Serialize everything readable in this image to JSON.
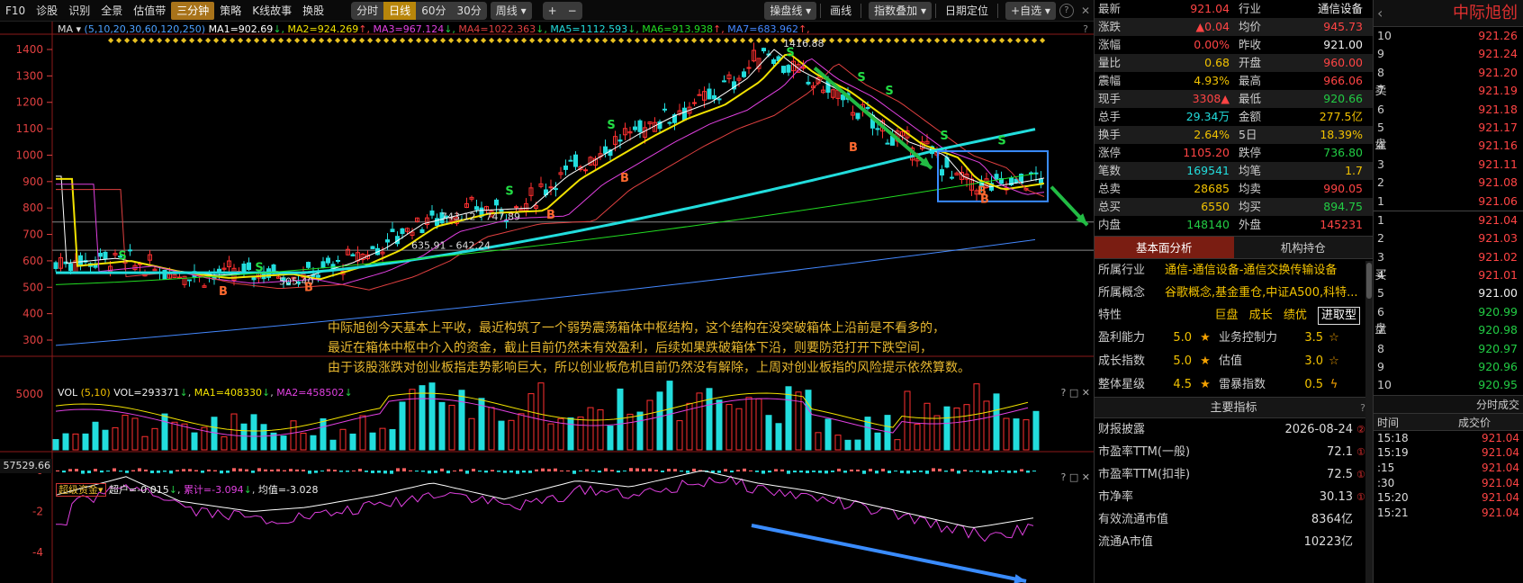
{
  "toolbar": {
    "left_items": [
      "F10",
      "诊股",
      "识别",
      "全景",
      "估值带",
      "三分钟",
      "策略",
      "K线故事",
      "换股"
    ],
    "active_index": 5,
    "periods": [
      "分时",
      "日线",
      "60分",
      "30分"
    ],
    "active_period": 1,
    "period_dropdown": "周线",
    "plus": "+",
    "minus": "−",
    "right_items": [
      "操盘线",
      "画线",
      "指数叠加",
      "日期定位",
      "+自选"
    ],
    "help": "?"
  },
  "chart": {
    "ma_legend": {
      "name": "MA",
      "params": "(5,10,20,30,60,120,250)",
      "items": [
        {
          "label": "MA1=902.69",
          "arrow": "↓",
          "color": "#ffffff"
        },
        {
          "label": "MA2=924.269",
          "arrow": "↑",
          "color": "#f2e200"
        },
        {
          "label": "MA3=967.124",
          "arrow": "↓",
          "color": "#e040e0"
        },
        {
          "label": "MA4=1022.363",
          "arrow": "↓",
          "color": "#e04040"
        },
        {
          "label": "MA5=1112.593",
          "arrow": "↓",
          "color": "#22dddd"
        },
        {
          "label": "MA6=913.938",
          "arrow": "↑",
          "color": "#22dd22"
        },
        {
          "label": "MA7=683.962",
          "arrow": "↑",
          "color": "#4488ff"
        }
      ]
    },
    "y_axis": [
      "1400",
      "1300",
      "1200",
      "1100",
      "1000",
      "900",
      "800",
      "700",
      "600",
      "500",
      "400",
      "300"
    ],
    "price_labels": {
      "high": "1416.88",
      "mid_zone": "743.12 - 747.89",
      "low_zone": "635.91 - 642.24",
      "low": "505.40"
    },
    "annotation": [
      "中际旭创今天基本上平收，最近构筑了一个弱势震荡箱体中枢结构，这个结构在没突破箱体上沿前是不看多的，",
      "最近在箱体中枢中介入的资金，截止目前仍然未有效盈利，后续如果跌破箱体下沿，则要防范打开下跌空间，",
      "由于该股涨跌对创业板指走势影响巨大，所以创业板危机目前仍然没有解除，上周对创业板指的风险提示依然算数。"
    ],
    "marker_s": "S",
    "marker_b": "B",
    "vol_legend": {
      "name": "VOL",
      "params": "(5,10)",
      "vol": "VOL=293371",
      "ma1": "MA1=408330",
      "ma2": "MA2=458502"
    },
    "vol_axis": [
      "5000"
    ],
    "vol_unit_value": "57529.66",
    "flow_legend": {
      "name": "超级资金",
      "chao": "超户=-0.015",
      "lei": "累计=-3.094",
      "jun": "均值=-3.028"
    },
    "flow_axis": [
      "0",
      "-2",
      "-4"
    ],
    "panel_icons": "? □ ✕"
  },
  "info": {
    "rows": [
      {
        "l1": "最新",
        "v1": "921.04",
        "c1": "red",
        "l2": "行业",
        "v2": "通信设备",
        "c2": "white"
      },
      {
        "l1": "涨跌",
        "v1": "▲0.04",
        "c1": "red",
        "l2": "均价",
        "v2": "945.73",
        "c2": "red"
      },
      {
        "l1": "涨幅",
        "v1": "0.00%",
        "c1": "red",
        "l2": "昨收",
        "v2": "921.00",
        "c2": "white"
      },
      {
        "l1": "量比",
        "v1": "0.68",
        "c1": "yellow",
        "l2": "开盘",
        "v2": "960.00",
        "c2": "red"
      },
      {
        "l1": "震幅",
        "v1": "4.93%",
        "c1": "yellow",
        "l2": "最高",
        "v2": "966.06",
        "c2": "red"
      },
      {
        "l1": "现手",
        "v1": "3308▲",
        "c1": "red",
        "l2": "最低",
        "v2": "920.66",
        "c2": "green"
      },
      {
        "l1": "总手",
        "v1": "29.34万",
        "c1": "cyan",
        "l2": "金额",
        "v2": "277.5亿",
        "c2": "yellow"
      },
      {
        "l1": "换手",
        "v1": "2.64%",
        "c1": "yellow",
        "l2": "5日",
        "v2": "18.39%",
        "c2": "yellow"
      },
      {
        "l1": "涨停",
        "v1": "1105.20",
        "c1": "red",
        "l2": "跌停",
        "v2": "736.80",
        "c2": "green"
      },
      {
        "l1": "笔数",
        "v1": "169541",
        "c1": "cyan",
        "l2": "均笔",
        "v2": "1.7",
        "c2": "yellow"
      },
      {
        "l1": "总卖",
        "v1": "28685",
        "c1": "yellow",
        "l2": "均卖",
        "v2": "990.05",
        "c2": "red"
      },
      {
        "l1": "总买",
        "v1": "6550",
        "c1": "yellow",
        "l2": "均买",
        "v2": "894.75",
        "c2": "green"
      },
      {
        "l1": "内盘",
        "v1": "148140",
        "c1": "green",
        "l2": "外盘",
        "v2": "145231",
        "c2": "red"
      }
    ],
    "tabs": [
      "基本面分析",
      "机构持仓"
    ],
    "industry_label": "所属行业",
    "industry": "通信-通信设备-通信交换传输设备",
    "concept_label": "所属概念",
    "concept": "谷歌概念,基金重仓,中证A500,科特...",
    "traits_label": "特性",
    "traits": [
      "巨盘",
      "成长",
      "绩优"
    ],
    "traits_boxed": "进取型",
    "ratings": [
      {
        "l1": "盈利能力",
        "n1": "5.0",
        "s1": "★",
        "l2": "业务控制力",
        "n2": "3.5",
        "s2": "☆"
      },
      {
        "l1": "成长指数",
        "n1": "5.0",
        "s1": "★",
        "l2": "估值",
        "n2": "3.0",
        "s2": "☆"
      },
      {
        "l1": "整体星级",
        "n1": "4.5",
        "s1": "★",
        "l2": "雷暴指数",
        "n2": "0.5",
        "s2": "ϟ"
      }
    ],
    "main_indicators_title": "主要指标",
    "indicators": [
      {
        "label": "财报披露",
        "value": "2026-08-24",
        "mark": "②"
      },
      {
        "label": "市盈率TTM(一般)",
        "value": "72.1",
        "mark": "①"
      },
      {
        "label": "市盈率TTM(扣非)",
        "value": "72.5",
        "mark": "①"
      },
      {
        "label": "市净率",
        "value": "30.13",
        "mark": "①"
      },
      {
        "label": "有效流通市值",
        "value": "8364亿",
        "mark": ""
      },
      {
        "label": "流通A市值",
        "value": "10223亿",
        "mark": ""
      }
    ]
  },
  "book": {
    "title": "中际旭创",
    "back": "‹",
    "sell_label": [
      "卖",
      "盘"
    ],
    "buy_label": [
      "买",
      "盘"
    ],
    "sell": [
      {
        "lvl": "10",
        "px": "921.26"
      },
      {
        "lvl": "9",
        "px": "921.24"
      },
      {
        "lvl": "8",
        "px": "921.20"
      },
      {
        "lvl": "7",
        "px": "921.19"
      },
      {
        "lvl": "6",
        "px": "921.18"
      },
      {
        "lvl": "5",
        "px": "921.17"
      },
      {
        "lvl": "4",
        "px": "921.16"
      },
      {
        "lvl": "3",
        "px": "921.11"
      },
      {
        "lvl": "2",
        "px": "921.08"
      },
      {
        "lvl": "1",
        "px": "921.06"
      }
    ],
    "buy": [
      {
        "lvl": "1",
        "px": "921.04",
        "c": "red"
      },
      {
        "lvl": "2",
        "px": "921.03",
        "c": "red"
      },
      {
        "lvl": "3",
        "px": "921.02",
        "c": "red"
      },
      {
        "lvl": "4",
        "px": "921.01",
        "c": "red"
      },
      {
        "lvl": "5",
        "px": "921.00",
        "c": "white"
      },
      {
        "lvl": "6",
        "px": "920.99",
        "c": "green"
      },
      {
        "lvl": "7",
        "px": "920.98",
        "c": "green"
      },
      {
        "lvl": "8",
        "px": "920.97",
        "c": "green"
      },
      {
        "lvl": "9",
        "px": "920.96",
        "c": "green"
      },
      {
        "lvl": "10",
        "px": "920.95",
        "c": "green"
      }
    ],
    "trades_title": "分时成交",
    "trade_headers": [
      "时间",
      "成交价"
    ],
    "trades": [
      {
        "t": "15:18",
        "p": "921.04"
      },
      {
        "t": "15:19",
        "p": "921.04"
      },
      {
        "t": ":15",
        "p": "921.04"
      },
      {
        "t": ":30",
        "p": "921.04"
      },
      {
        "t": "15:20",
        "p": "921.04"
      },
      {
        "t": "15:21",
        "p": "921.04"
      }
    ]
  }
}
